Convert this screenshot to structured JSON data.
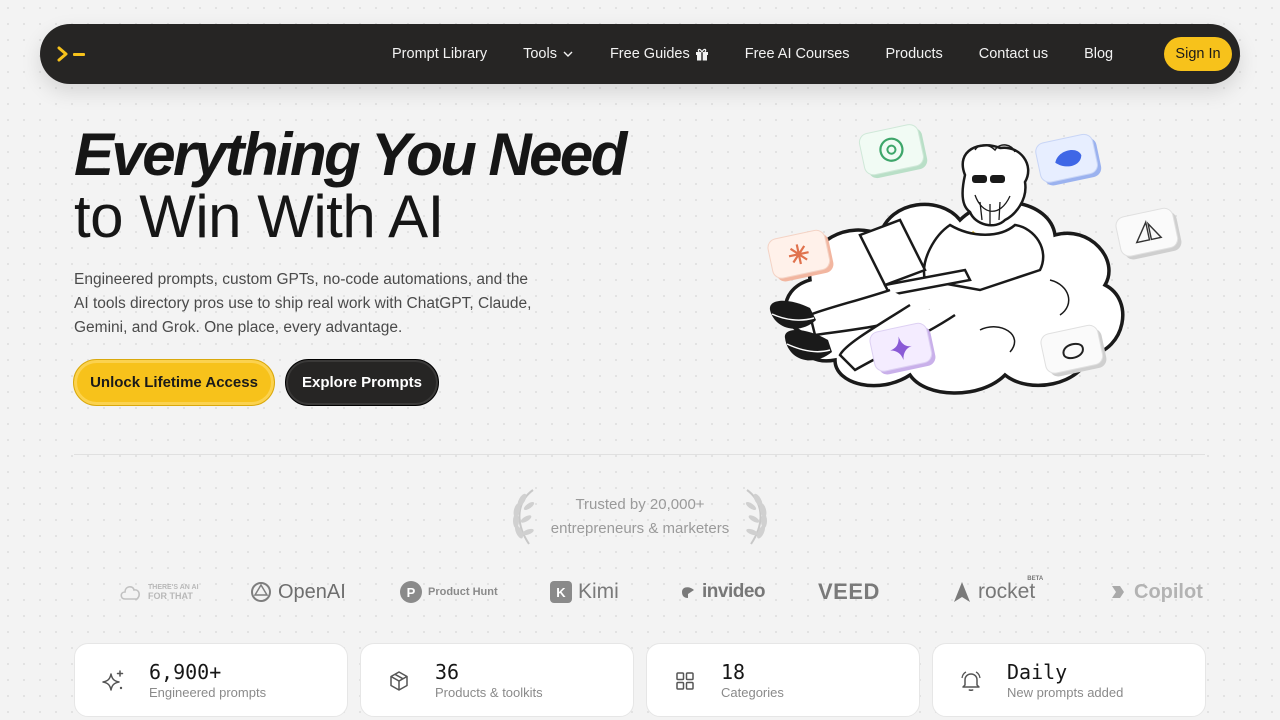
{
  "nav": {
    "links": [
      {
        "label": "Prompt Library"
      },
      {
        "label": "Tools",
        "icon": "chevron-down-icon"
      },
      {
        "label": "Free Guides",
        "icon": "gift-icon"
      },
      {
        "label": "Free AI Courses"
      },
      {
        "label": "Products"
      },
      {
        "label": "Contact us"
      },
      {
        "label": "Blog"
      }
    ],
    "signin_label": "Sign In"
  },
  "hero": {
    "title_line1": "Everything You Need",
    "title_line2": "to Win With AI",
    "description": "Engineered prompts, custom GPTs, no-code automations, and the AI tools directory pros use to ship real work with ChatGPT, Claude, Gemini, and Grok. One place, every advantage.",
    "primary_cta": "Unlock Lifetime Access",
    "secondary_cta": "Explore Prompts"
  },
  "trust": {
    "line1": "Trusted by 20,000+",
    "line2": "entrepreneurs & marketers"
  },
  "logos": [
    {
      "name": "THERE'S AN AI FOR THAT",
      "line1": "THERE'S AN AI",
      "line2": "FOR THAT"
    },
    {
      "name": "OpenAI"
    },
    {
      "name": "Product Hunt",
      "badge": "P"
    },
    {
      "name": "Kimi",
      "badge": "K"
    },
    {
      "name": "invideo"
    },
    {
      "name": "VEED"
    },
    {
      "name": "rocket",
      "tag": "BETA"
    },
    {
      "name": "Copilot"
    }
  ],
  "stats": [
    {
      "value": "6,900+",
      "label": "Engineered prompts",
      "icon": "sparkles-icon"
    },
    {
      "value": "36",
      "label": "Products & toolkits",
      "icon": "box-icon"
    },
    {
      "value": "18",
      "label": "Categories",
      "icon": "grid-icon"
    },
    {
      "value": "Daily",
      "label": "New prompts added",
      "icon": "bell-icon"
    }
  ],
  "colors": {
    "accent": "#f7c21b",
    "dark": "#262524",
    "background": "#f3f3f3"
  }
}
